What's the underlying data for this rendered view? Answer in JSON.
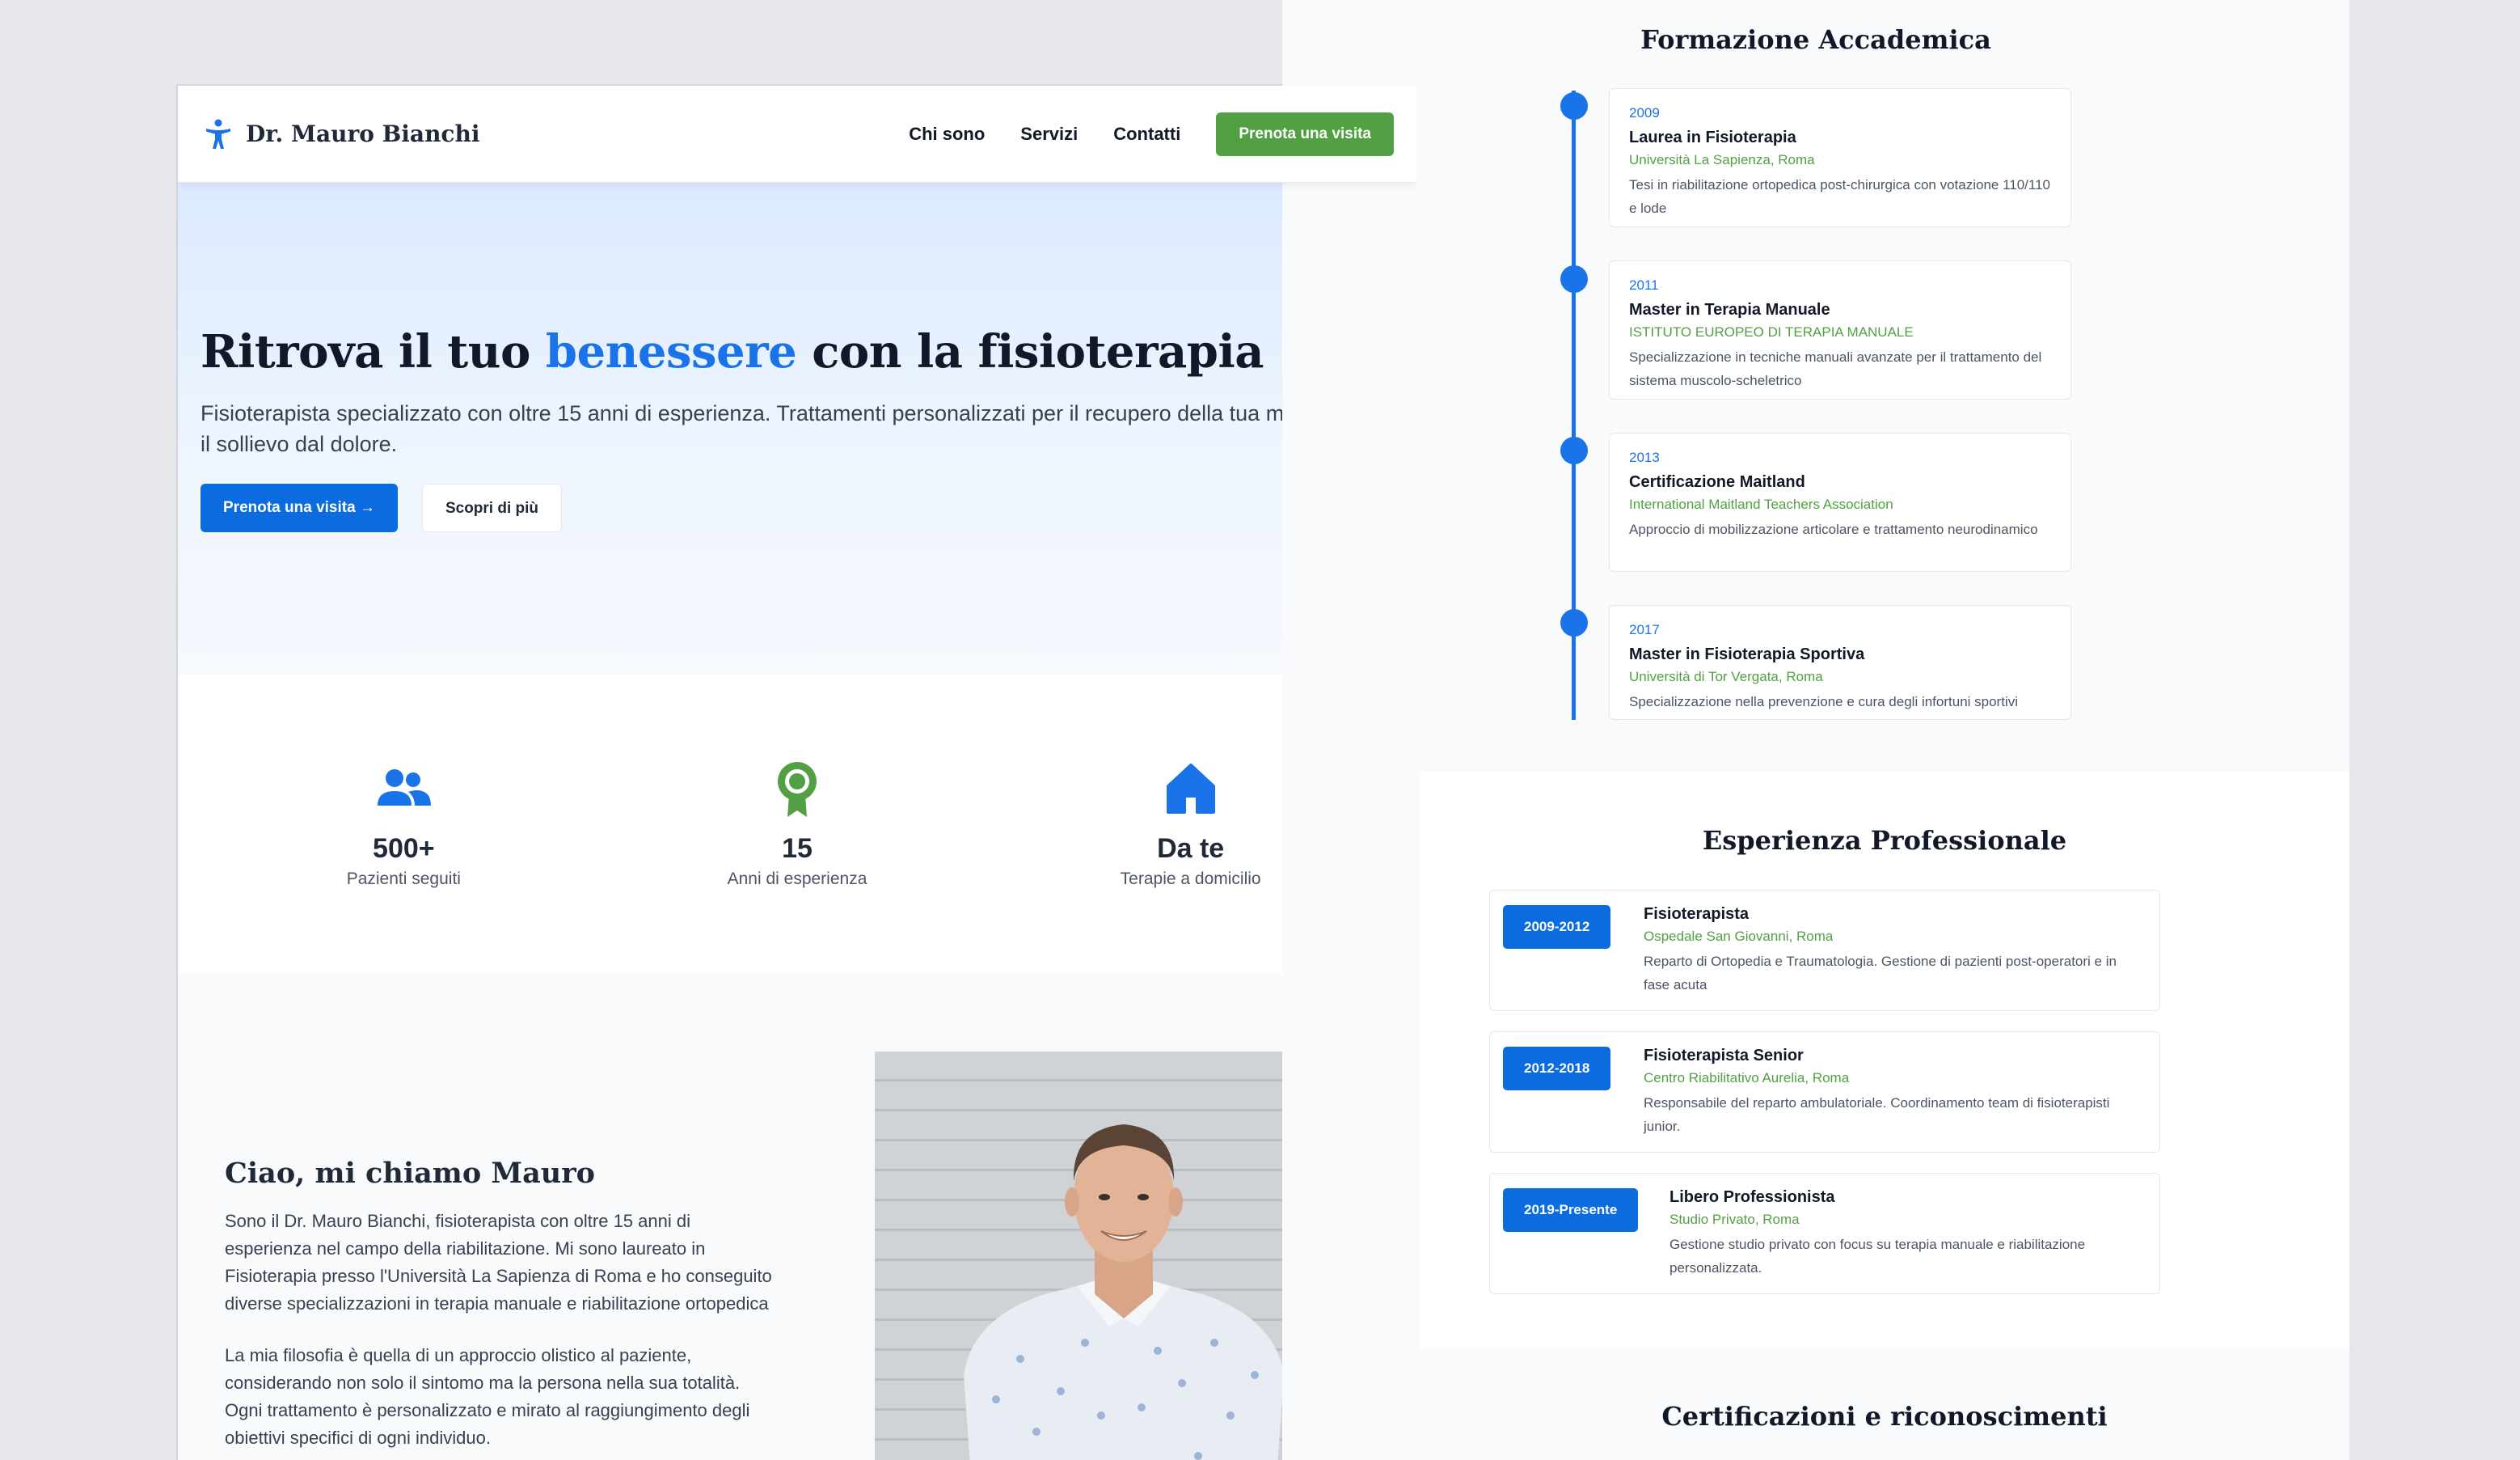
{
  "nav": {
    "brand": "Dr. Mauro Bianchi",
    "links": [
      "Chi sono",
      "Servizi",
      "Contatti"
    ],
    "cta": "Prenota una visita"
  },
  "hero": {
    "title_pre": "Ritrova il tuo ",
    "title_accent": "benessere",
    "title_post": " con la fisioterapia",
    "subtitle": "Fisioterapista specializzato con oltre 15 anni di esperienza. Trattamenti personalizzati per il recupero della tua mobilità e il sollievo dal dolore.",
    "primary_button": "Prenota una visita →",
    "secondary_button": "Scopri di più"
  },
  "stats": [
    {
      "value": "500+",
      "label": "Pazienti seguiti",
      "icon": "users-icon"
    },
    {
      "value": "15",
      "label": "Anni di esperienza",
      "icon": "award-icon"
    },
    {
      "value": "Da te",
      "label": "Terapie a domicilio",
      "icon": "home-icon"
    }
  ],
  "about": {
    "title": "Ciao, mi chiamo Mauro",
    "p1": "Sono il Dr. Mauro Bianchi, fisioterapista con oltre 15 anni di esperienza nel campo della riabilitazione. Mi sono laureato in Fisioterapia presso l'Università La Sapienza di Roma e ho conseguito diverse specializzazioni in terapia manuale e riabilitazione ortopedica",
    "p2": "La mia filosofia è quella di un approccio olistico al paziente, considerando non solo il sintomo ma la persona nella sua totalità. Ogni trattamento è personalizzato e mirato al raggiungimento degli obiettivi specifici di ogni individuo."
  },
  "education": {
    "title": "Formazione Accademica",
    "items": [
      {
        "year": "2009",
        "title": "Laurea in Fisioterapia",
        "org": "Università La Sapienza, Roma",
        "desc": "Tesi in riabilitazione ortopedica post-chirurgica con votazione 110/110 e lode"
      },
      {
        "year": "2011",
        "title": "Master in Terapia Manuale",
        "org": "ISTITUTO EUROPEO DI TERAPIA MANUALE",
        "desc": "Specializzazione in tecniche manuali avanzate per il trattamento del sistema muscolo-scheletrico"
      },
      {
        "year": "2013",
        "title": "Certificazione Maitland",
        "org": "International Maitland Teachers Association",
        "desc": "Approccio di mobilizzazione articolare e trattamento neurodinamico"
      },
      {
        "year": "2017",
        "title": "Master in Fisioterapia Sportiva",
        "org": "Università di Tor Vergata, Roma",
        "desc": "Specializzazione nella prevenzione e cura degli infortuni sportivi"
      }
    ]
  },
  "experience": {
    "title": "Esperienza Professionale",
    "items": [
      {
        "period": "2009-2012",
        "title": "Fisioterapista",
        "org": "Ospedale San Giovanni, Roma",
        "desc": "Reparto di Ortopedia e Traumatologia. Gestione di pazienti post-operatori e in fase acuta"
      },
      {
        "period": "2012-2018",
        "title": "Fisioterapista Senior",
        "org": "Centro Riabilitativo Aurelia, Roma",
        "desc": "Responsabile del reparto ambulatoriale. Coordinamento team di fisioterapisti junior."
      },
      {
        "period": "2019-Presente",
        "title": "Libero Professionista",
        "org": "Studio Privato, Roma",
        "desc": "Gestione studio privato con focus su terapia manuale e riabilitazione personalizzata."
      }
    ]
  },
  "certifications": {
    "title": "Certificazioni e riconoscimenti"
  },
  "colors": {
    "primary": "#1a73e8",
    "green": "#52a043",
    "button_blue": "#0b6ce0"
  }
}
